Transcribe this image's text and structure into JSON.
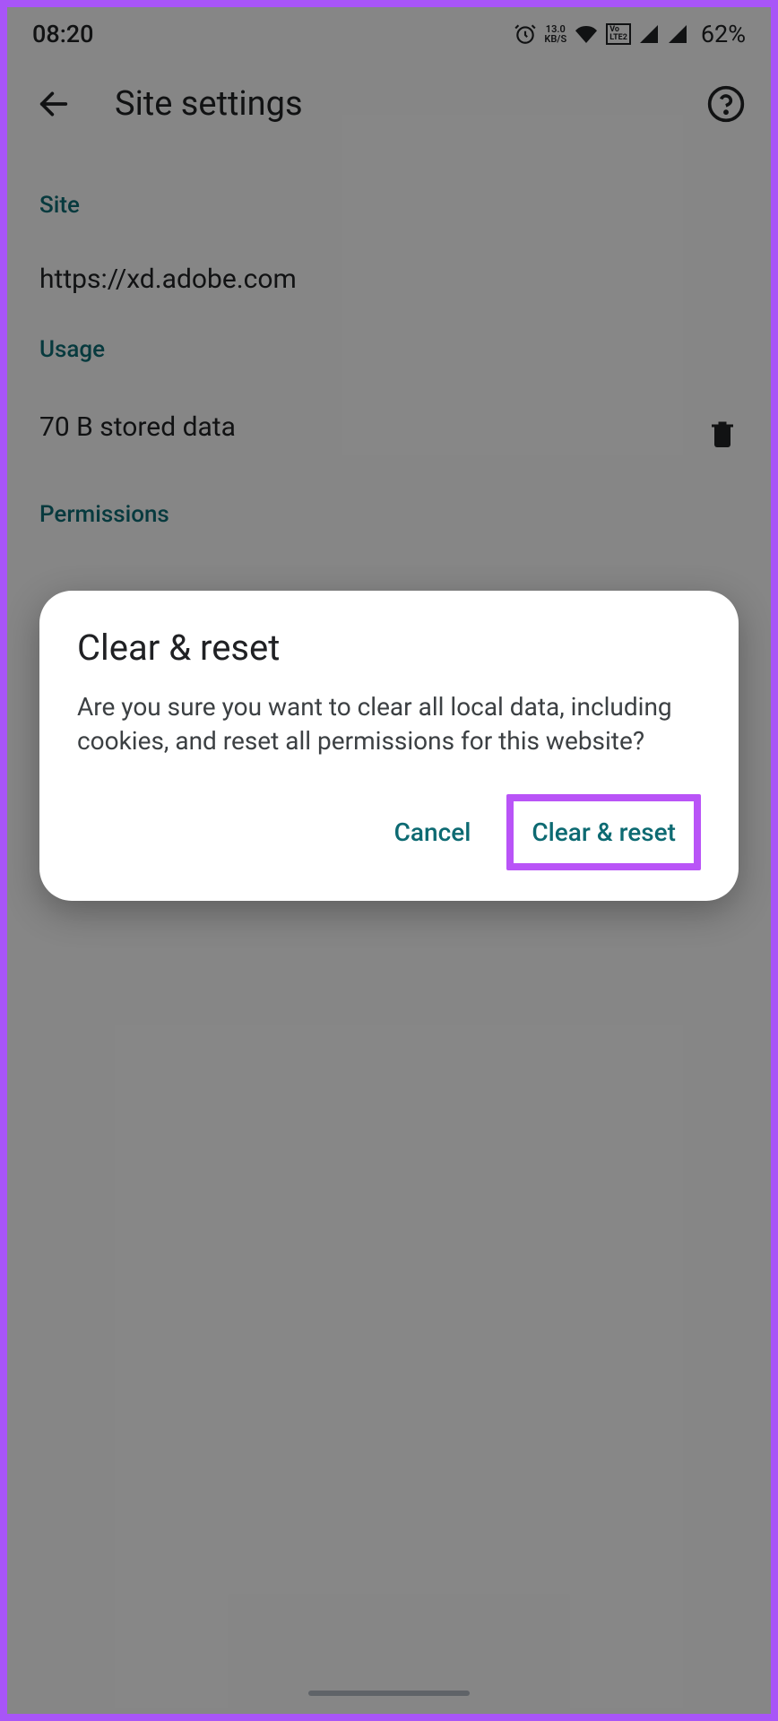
{
  "statusBar": {
    "time": "08:20",
    "dataSpeed": "13.0",
    "dataUnit": "KB/S",
    "volte": "VoLTE2",
    "battery": "62%"
  },
  "appBar": {
    "title": "Site settings"
  },
  "sections": {
    "site": {
      "header": "Site",
      "value": "https://xd.adobe.com"
    },
    "usage": {
      "header": "Usage",
      "value": "70 B stored data"
    },
    "permissions": {
      "header": "Permissions"
    }
  },
  "dialog": {
    "title": "Clear & reset",
    "message": "Are you sure you want to clear all local data, including cookies, and reset all permissions for this website?",
    "cancel": "Cancel",
    "confirm": "Clear & reset"
  }
}
